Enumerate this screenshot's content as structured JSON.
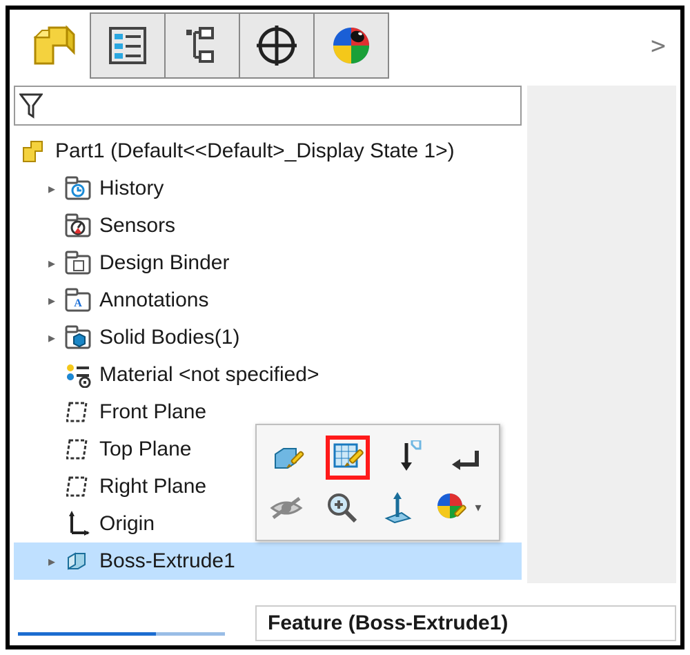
{
  "tree": {
    "root": {
      "label": "Part1  (Default<<Default>_Display State 1>)"
    },
    "items": [
      {
        "label": "History",
        "expandable": true,
        "icon": "history"
      },
      {
        "label": "Sensors",
        "expandable": false,
        "icon": "sensors"
      },
      {
        "label": "Design Binder",
        "expandable": true,
        "icon": "folder"
      },
      {
        "label": "Annotations",
        "expandable": true,
        "icon": "annotation"
      },
      {
        "label": "Solid Bodies(1)",
        "expandable": true,
        "icon": "solid"
      },
      {
        "label": "Material <not specified>",
        "expandable": false,
        "icon": "material"
      },
      {
        "label": "Front Plane",
        "expandable": false,
        "icon": "plane"
      },
      {
        "label": "Top Plane",
        "expandable": false,
        "icon": "plane"
      },
      {
        "label": "Right Plane",
        "expandable": false,
        "icon": "plane"
      },
      {
        "label": "Origin",
        "expandable": false,
        "icon": "origin"
      },
      {
        "label": "Boss-Extrude1",
        "expandable": true,
        "icon": "extrude",
        "selected": true
      }
    ]
  },
  "tooltip": {
    "text": "Feature (Boss-Extrude1)"
  },
  "caret": {
    "glyph": ">"
  }
}
